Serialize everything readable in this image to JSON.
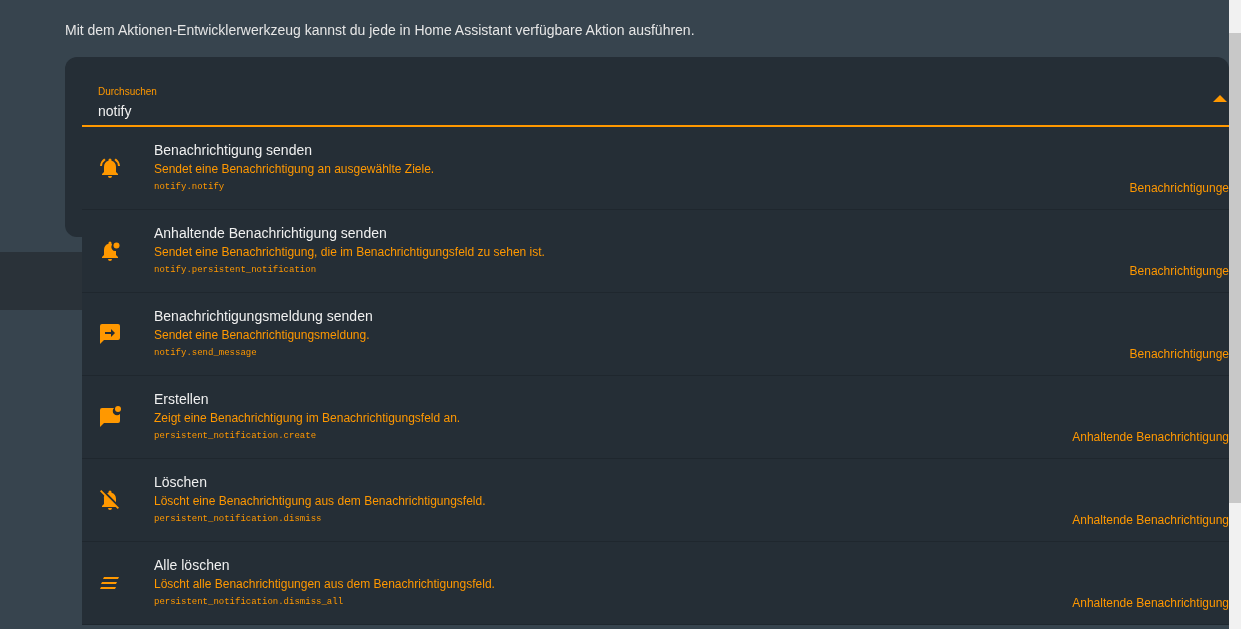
{
  "intro": "Mit dem Aktionen-Entwicklerwerkzeug kannst du jede in Home Assistant verfügbare Aktion ausführen.",
  "search": {
    "label": "Durchsuchen",
    "value": "notify",
    "expanded": true
  },
  "actions": [
    {
      "title": "Benachrichtigung senden",
      "description": "Sendet eine Benachrichtigung an ausgewählte Ziele.",
      "service": "notify.notify",
      "domain": "Benachrichtigunge"
    },
    {
      "title": "Anhaltende Benachrichtigung senden",
      "description": "Sendet eine Benachrichtigung, die im Benachrichtigungsfeld zu sehen ist.",
      "service": "notify.persistent_notification",
      "domain": "Benachrichtigunge"
    },
    {
      "title": "Benachrichtigungsmeldung senden",
      "description": "Sendet eine Benachrichtigungsmeldung.",
      "service": "notify.send_message",
      "domain": "Benachrichtigunge"
    },
    {
      "title": "Erstellen",
      "description": "Zeigt eine Benachrichtigung im Benachrichtigungsfeld an.",
      "service": "persistent_notification.create",
      "domain": "Anhaltende Benachrichtigung"
    },
    {
      "title": "Löschen",
      "description": "Löscht eine Benachrichtigung aus dem Benachrichtigungsfeld.",
      "service": "persistent_notification.dismiss",
      "domain": "Anhaltende Benachrichtigung"
    },
    {
      "title": "Alle löschen",
      "description": "Löscht alle Benachrichtigungen aus dem Benachrichtigungsfeld.",
      "service": "persistent_notification.dismiss_all",
      "domain": "Anhaltende Benachrichtigung"
    }
  ]
}
